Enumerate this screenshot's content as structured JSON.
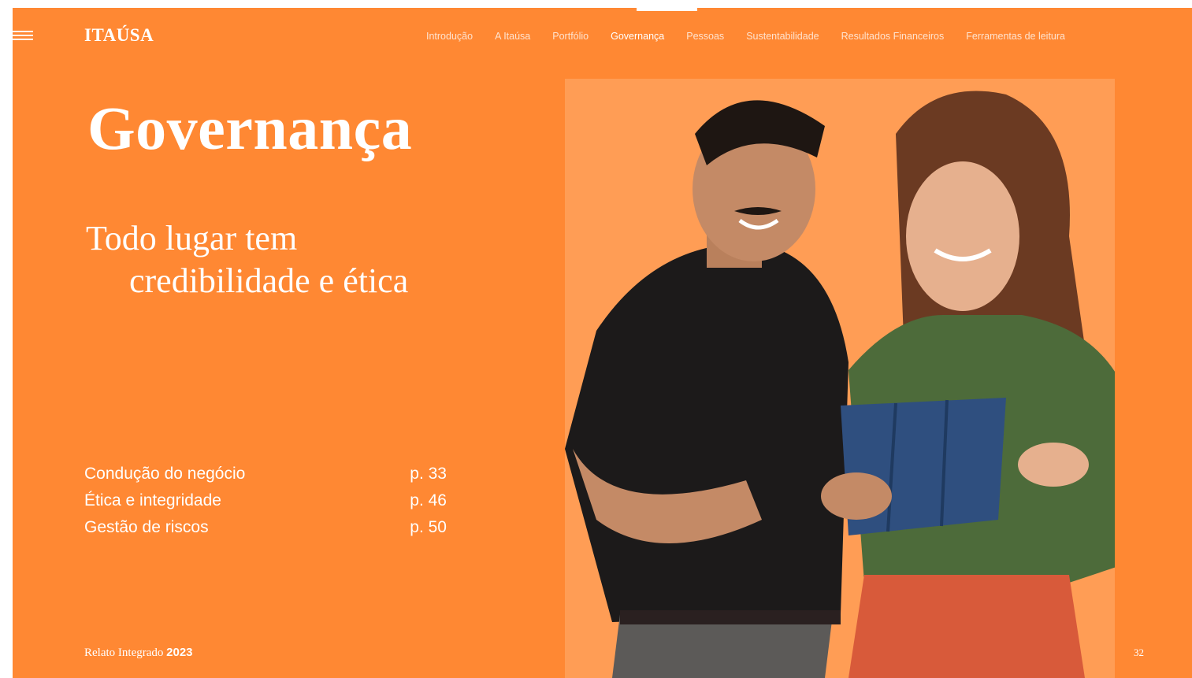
{
  "header": {
    "logo": "ITAÚSA",
    "nav": [
      {
        "label": "Introdução"
      },
      {
        "label": "A Itaúsa"
      },
      {
        "label": "Portfólio"
      },
      {
        "label": "Governança"
      },
      {
        "label": "Pessoas"
      },
      {
        "label": "Sustentabilidade"
      },
      {
        "label": "Resultados Financeiros"
      },
      {
        "label": "Ferramentas de leitura"
      }
    ],
    "active_nav": "Governança"
  },
  "main": {
    "title": "Governança",
    "subtitle_line1": "Todo lugar tem",
    "subtitle_line2": "credibilidade e ética",
    "toc": [
      {
        "label": "Condução do negócio",
        "page": "p. 33"
      },
      {
        "label": "Ética e integridade",
        "page": "p. 46"
      },
      {
        "label": "Gestão de riscos",
        "page": "p. 50"
      }
    ]
  },
  "footer": {
    "report_label": "Relato Integrado",
    "year": "2023",
    "page_number": "32"
  },
  "colors": {
    "background": "#FF8833",
    "photo_panel": "#FF9D55",
    "text": "#FFFFFF"
  },
  "icons": {
    "menu": "hamburger-menu-icon"
  }
}
